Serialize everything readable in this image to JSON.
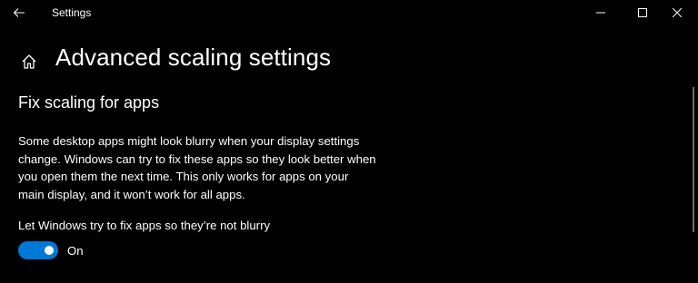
{
  "window": {
    "title": "Settings",
    "back_icon": "arrow-left-icon",
    "minimize_icon": "minimize-icon",
    "maximize_icon": "maximize-icon",
    "close_icon": "close-icon"
  },
  "header": {
    "home_icon": "home-icon",
    "title": "Advanced scaling settings"
  },
  "section": {
    "heading": "Fix scaling for apps",
    "description_lines": [
      "Some desktop apps might look blurry when your display settings",
      "change. Windows can try to fix these apps so they look better when",
      "you open them the next time. This only works for apps on your",
      "main display, and it won’t work for all apps."
    ],
    "toggle_label": "Let Windows try to fix apps so they’re not blurry",
    "toggle_state": "On",
    "toggle_on": true
  },
  "colors": {
    "background": "#000000",
    "text": "#ffffff",
    "accent": "#0078d7"
  }
}
